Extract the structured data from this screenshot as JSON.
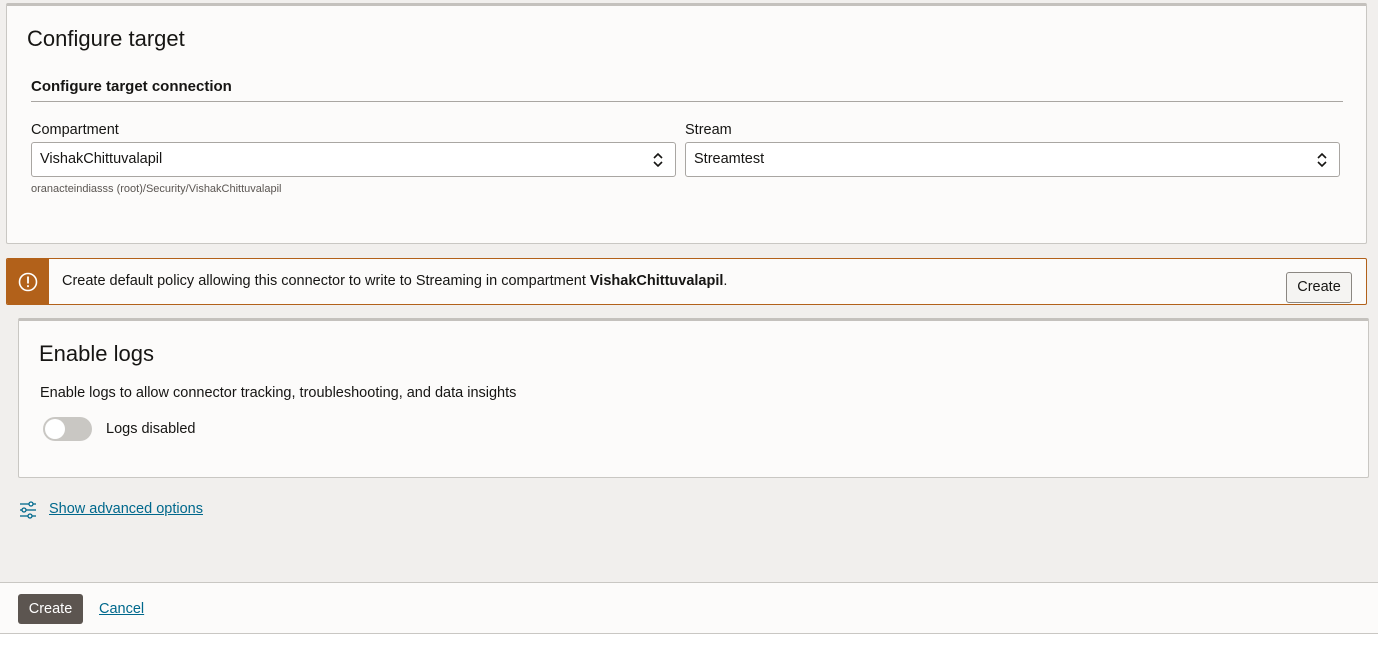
{
  "target": {
    "title": "Configure target",
    "section_title": "Configure target connection",
    "compartment": {
      "label": "Compartment",
      "value": "VishakChittuvalapil",
      "helper": "oranacteindiasss (root)/Security/VishakChittuvalapil"
    },
    "stream": {
      "label": "Stream",
      "value": "Streamtest"
    }
  },
  "alert": {
    "text_prefix": "Create default policy allowing this connector to write to Streaming in compartment ",
    "compartment": "VishakChittuvalapil",
    "text_suffix": ".",
    "button_label": "Create",
    "color": "#b2611a"
  },
  "logs": {
    "title": "Enable logs",
    "description": "Enable logs to allow connector tracking, troubleshooting, and data insights",
    "toggle_label": "Logs disabled",
    "enabled": false
  },
  "advanced": {
    "link_label": "Show advanced options",
    "icon": "sliders-icon"
  },
  "footer": {
    "create_label": "Create",
    "cancel_label": "Cancel"
  }
}
